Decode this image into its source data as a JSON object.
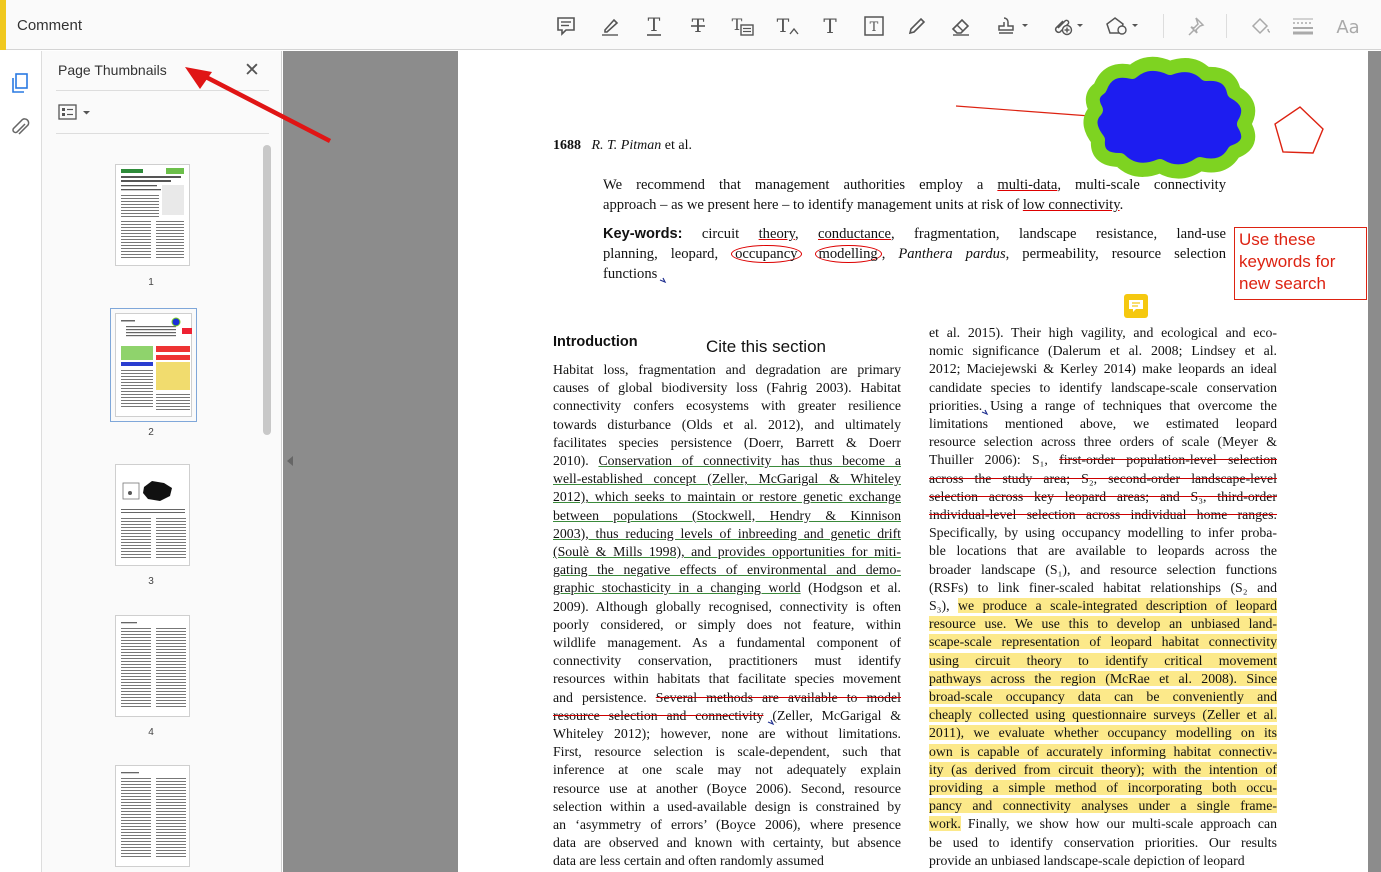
{
  "toolbar": {
    "title": "Comment",
    "tools": [
      "sticky-note",
      "highlight",
      "underline",
      "strikethrough",
      "replace-text",
      "insert-text",
      "add-text",
      "text-box",
      "pencil",
      "eraser",
      "stamp",
      "attach",
      "shapes",
      "pin",
      "fill",
      "lines",
      "text-properties"
    ]
  },
  "panel": {
    "title": "Page Thumbnails",
    "close": "✕",
    "thumbnails": [
      {
        "label": "1"
      },
      {
        "label": "2",
        "selected": true
      },
      {
        "label": "3"
      },
      {
        "label": "4"
      },
      {
        "label": ""
      }
    ]
  },
  "doc": {
    "page_header_num": "1688",
    "page_header_auth": "R. T. Pitman",
    "page_header_etal": " et al.",
    "abstract": {
      "l1a": "We recommend that management authorities employ a ",
      "l1b": "multi-data",
      "l1c": ", multi-scale connectivity",
      "l2a": "approach – as we present here – to identify management units at risk of ",
      "l2b": "low connectivity",
      "l2c": "."
    },
    "keywords": {
      "label": "Key-words:",
      "k1": " circuit ",
      "k2": "theory",
      "k3": ", ",
      "k4": "conductance",
      "k5": ", fragmentation, landscape resistance, land-use",
      "k6": "planning, leopard, ",
      "k7": "occupancy",
      "k8": " ",
      "k9": "modelling",
      "k10": ", ",
      "k11": "Panthera pardus",
      "k12": ", permeability, resource selection",
      "k13": "functions"
    },
    "intro_heading": "Introduction",
    "cite_text": "Cite this section",
    "left_col": [
      {
        "t": "Habitat loss, fragmentation and degradation are primary"
      },
      {
        "t": "causes of global biodiversity loss (Fahrig 2003). Habitat"
      },
      {
        "t": "connectivity confers ecosystems with greater resilience"
      },
      {
        "t": "towards disturbance (Olds et al. 2012), and ultimately"
      },
      {
        "t": "facilitates species persistence (Doerr, Barrett & Doerr"
      },
      {
        "a": "2010). ",
        "g": "Conservation of connectivity has thus become a"
      },
      {
        "g": "well-established concept (Zeller, McGarigal & Whiteley"
      },
      {
        "g": "2012), which seeks to maintain or restore genetic exchange"
      },
      {
        "g": "between populations (Stockwell, Hendry & Kinnison"
      },
      {
        "g": "2003), thus reducing levels of inbreeding and genetic drift"
      },
      {
        "g": "(Soulè & Mills 1998), and provides opportunities for miti-"
      },
      {
        "g": "gating the negative effects of environmental and demo-"
      },
      {
        "g": "graphic stochasticity in a changing world",
        "b": " (Hodgson et al."
      },
      {
        "t": "2009). Although globally recognised, connectivity is often"
      },
      {
        "t": "poorly considered, or simply does not feature, within"
      },
      {
        "t": "wildlife management. As a fundamental component of"
      },
      {
        "t": "connectivity conservation, practitioners must identify"
      },
      {
        "t": "resources within habitats that facilitate species movement"
      },
      {
        "a": "and persistence. ",
        "s": "Several methods are available to model"
      },
      {
        "s": "resource selection and connectivity",
        "b": " (Zeller, McGarigal &"
      },
      {
        "t": "Whiteley 2012); however, none are without limitations."
      },
      {
        "t": "First, resource selection is scale-dependent, such that"
      },
      {
        "t": "inference at one scale may not adequately explain"
      },
      {
        "t": "resource use at another (Boyce 2006). Second, resource"
      },
      {
        "t": "selection within a used-available design is constrained by"
      },
      {
        "t": "an ‘asymmetry of errors’ (Boyce 2006), where presence"
      },
      {
        "t": "data are observed and known with certainty, but absence"
      },
      {
        "t": "data are less certain and often randomly assumed"
      }
    ],
    "right_col": [
      {
        "t": "et al. 2015). Their high vagility, and ecological and eco-"
      },
      {
        "t": "nomic significance (Dalerum et al. 2008; Lindsey et al."
      },
      {
        "t": "2012; Maciejewski & Kerley 2014) make leopards an ideal"
      },
      {
        "t": "candidate species to identify landscape-scale conservation"
      },
      {
        "t": "priorities. Using a range of techniques that overcome the"
      },
      {
        "t": "limitations mentioned above, we estimated leopard"
      },
      {
        "t": "resource selection across three orders of scale (Meyer &"
      },
      {
        "a": "Thuiller 2006): S₁, ",
        "s": "first-order population-level selection"
      },
      {
        "s": "across the study area; S₂, second-order landscape-level"
      },
      {
        "s": "selection across key leopard areas; and S₃, third-order"
      },
      {
        "s": "individual-level selection across individual home ranges."
      },
      {
        "t": "Specifically, by using occupancy modelling to infer proba-"
      },
      {
        "t": "ble locations that are available to leopards across the"
      },
      {
        "t": "broader landscape (S₁), and resource selection functions"
      },
      {
        "t": "(RSFs) to link finer-scaled habitat relationships (S₂ and"
      },
      {
        "a": "S₃), ",
        "h": "we produce a scale-integrated description of leopard"
      },
      {
        "h": "resource use. We use this to develop an unbiased land-"
      },
      {
        "h": "scape-scale representation of leopard habitat connectivity"
      },
      {
        "h": "using circuit theory to identify critical movement"
      },
      {
        "h": "pathways across the region (McRae et al. 2008). Since"
      },
      {
        "h": "broad-scale occupancy data can be conveniently and"
      },
      {
        "h": "cheaply collected using questionnaire surveys (Zeller et al."
      },
      {
        "h": "2011), we evaluate whether occupancy modelling on its"
      },
      {
        "h": "own is capable of accurately informing habitat connectiv-"
      },
      {
        "h": "ity (as derived from circuit theory); with the intention of"
      },
      {
        "h": "providing a simple method of incorporating both occu-"
      },
      {
        "h": "pancy and connectivity analyses under a single frame-"
      },
      {
        "h": "work.",
        "b": " Finally, we show how our multi-scale approach can"
      },
      {
        "t": "be used to identify conservation priorities. Our results"
      },
      {
        "t": "provide an unbiased landscape-scale depiction of leopard"
      }
    ],
    "note_text": "Use these keywords for new search"
  },
  "colors": {
    "annot_red": "#dd1111",
    "highlight": "#fce98a",
    "cloud_fill": "#0000ee",
    "cloud_border": "#7ed321",
    "accent": "#f0c81e"
  }
}
